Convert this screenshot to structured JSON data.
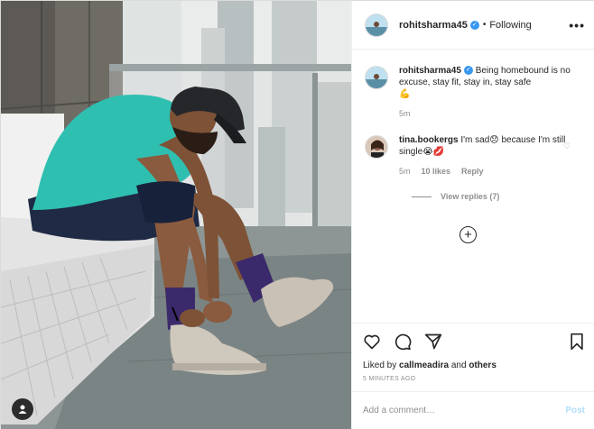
{
  "post": {
    "username": "rohitsharma45",
    "separator": "•",
    "follow_status": "Following",
    "more_label": "•••"
  },
  "caption": {
    "username": "rohitsharma45",
    "text": "Being homebound is no excuse, stay fit, stay in, stay safe",
    "emoji": "💪",
    "age": "5m"
  },
  "comments": [
    {
      "username": "tina.bookergs",
      "text": "I'm sad😞 because I'm still single😭💋",
      "age": "5m",
      "likes": "10 likes",
      "reply_label": "Reply",
      "view_replies": "View replies (7)"
    }
  ],
  "actions": {
    "liked_prefix": "Liked by",
    "liked_user": "callmeadira",
    "liked_and": "and",
    "liked_others": "others",
    "timestamp": "5 MINUTES AGO"
  },
  "composer": {
    "placeholder": "Add a comment…",
    "post_label": "Post"
  },
  "icons": [
    "heart-icon",
    "comment-icon",
    "share-icon",
    "bookmark-icon",
    "plus-circle-icon",
    "user-tag-icon",
    "verified-badge-icon",
    "more-icon"
  ],
  "colors": {
    "accent": "#3897f0",
    "post_disabled": "#b2dffc",
    "muted": "#8e8e8e"
  }
}
